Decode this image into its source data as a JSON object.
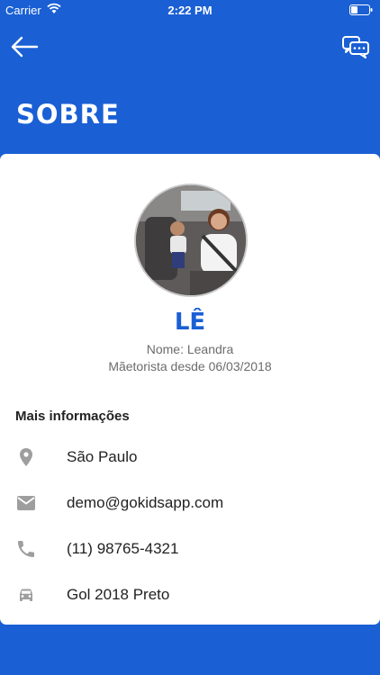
{
  "status_bar": {
    "carrier": "Carrier",
    "time": "2:22 PM"
  },
  "header": {
    "title": "SOBRE",
    "back_icon": "arrow-left-icon",
    "chat_icon": "chat-bubbles-icon"
  },
  "profile": {
    "nickname": "LÊ",
    "name_line": "Nome: Leandra",
    "since_line": "Mãetorista desde 06/03/2018"
  },
  "info": {
    "section_title": "Mais informações",
    "items": [
      {
        "icon": "location-pin-icon",
        "text": "São Paulo"
      },
      {
        "icon": "mail-icon",
        "text": "demo@gokidsapp.com"
      },
      {
        "icon": "phone-icon",
        "text": "(11) 98765-4321"
      },
      {
        "icon": "car-icon",
        "text": "Gol 2018 Preto"
      }
    ]
  },
  "colors": {
    "brand_blue": "#1a5fd4",
    "icon_gray": "#9e9e9e"
  }
}
